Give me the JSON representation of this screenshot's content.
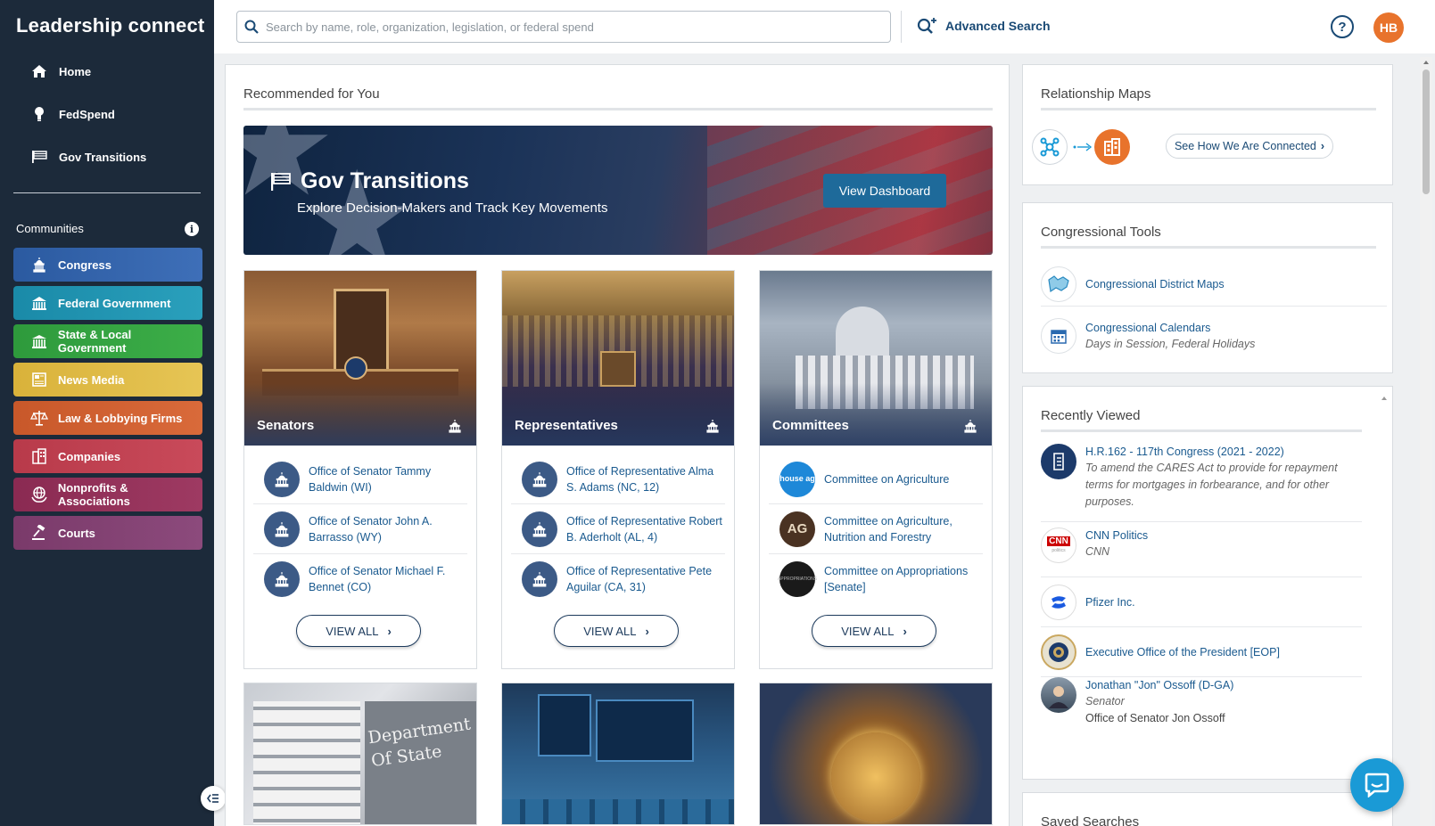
{
  "app": {
    "logo": "Leadership connect"
  },
  "nav": {
    "items": [
      {
        "label": "Home",
        "icon": "home-icon"
      },
      {
        "label": "FedSpend",
        "icon": "lightbulb-icon"
      },
      {
        "label": "Gov Transitions",
        "icon": "flag-icon"
      }
    ]
  },
  "communities": {
    "label": "Communities",
    "items": [
      {
        "label": "Congress",
        "color": "#2b5aa0"
      },
      {
        "label": "Federal Government",
        "color": "#1a8aa8"
      },
      {
        "label": "State & Local Government",
        "color": "#2e9a3c"
      },
      {
        "label": "News Media",
        "color": "#d9b23a"
      },
      {
        "label": "Law & Lobbying Firms",
        "color": "#c8582a"
      },
      {
        "label": "Companies",
        "color": "#b83a4a"
      },
      {
        "label": "Nonprofits & Associations",
        "color": "#8a2a52"
      },
      {
        "label": "Courts",
        "color": "#7a3a6a"
      }
    ]
  },
  "search": {
    "placeholder": "Search by name, role, organization, legislation, or federal spend",
    "value": "",
    "advanced_label": "Advanced Search"
  },
  "user": {
    "initials": "HB",
    "help": "?"
  },
  "main": {
    "section_title": "Recommended for You",
    "hero": {
      "title": "Gov Transitions",
      "subtitle": "Explore Decision-Makers and Track Key Movements",
      "button": "View Dashboard"
    },
    "cards": [
      {
        "label": "Senators",
        "items": [
          "Office of Senator Tammy Baldwin (WI)",
          "Office of Senator John A. Barrasso (WY)",
          "Office of Senator Michael F. Bennet (CO)"
        ],
        "view_all": "VIEW ALL"
      },
      {
        "label": "Representatives",
        "items": [
          "Office of Representative Alma S. Adams (NC, 12)",
          "Office of Representative Robert B. Aderholt (AL, 4)",
          "Office of Representative Pete Aguilar (CA, 31)"
        ],
        "view_all": "VIEW ALL"
      },
      {
        "label": "Committees",
        "items": [
          "Committee on Agriculture",
          "Committee on Agriculture, Nutrition and Forestry",
          "Committee on Appropriations [Senate]"
        ],
        "badges": [
          "house ag",
          "AG",
          "APPROPRIATIONS"
        ],
        "view_all": "VIEW ALL"
      }
    ],
    "thumb_texts": {
      "dept": "Department Of State"
    }
  },
  "relationship": {
    "title": "Relationship Maps",
    "button": "See How We Are Connected"
  },
  "tools": {
    "title": "Congressional Tools",
    "items": [
      {
        "label": "Congressional District Maps",
        "sub": ""
      },
      {
        "label": "Congressional Calendars",
        "sub": "Days in Session, Federal Holidays"
      }
    ]
  },
  "recent": {
    "title": "Recently Viewed",
    "items": [
      {
        "title": "H.R.162 - 117th Congress (2021 - 2022)",
        "sub": "To amend the CARES Act to provide for repayment terms for mortgages in forbearance, and for other purposes.",
        "extra": ""
      },
      {
        "title": "CNN Politics",
        "sub": "CNN",
        "extra": "",
        "badge": "CNN",
        "badge_sub": "politics"
      },
      {
        "title": "Pfizer Inc.",
        "sub": "",
        "extra": ""
      },
      {
        "title": "Executive Office of the President [EOP]",
        "sub": "",
        "extra": ""
      },
      {
        "title": "Jonathan \"Jon\" Ossoff (D-GA)",
        "sub": "Senator",
        "extra": "Office of Senator Jon Ossoff"
      }
    ]
  },
  "saved": {
    "title": "Saved Searches"
  }
}
